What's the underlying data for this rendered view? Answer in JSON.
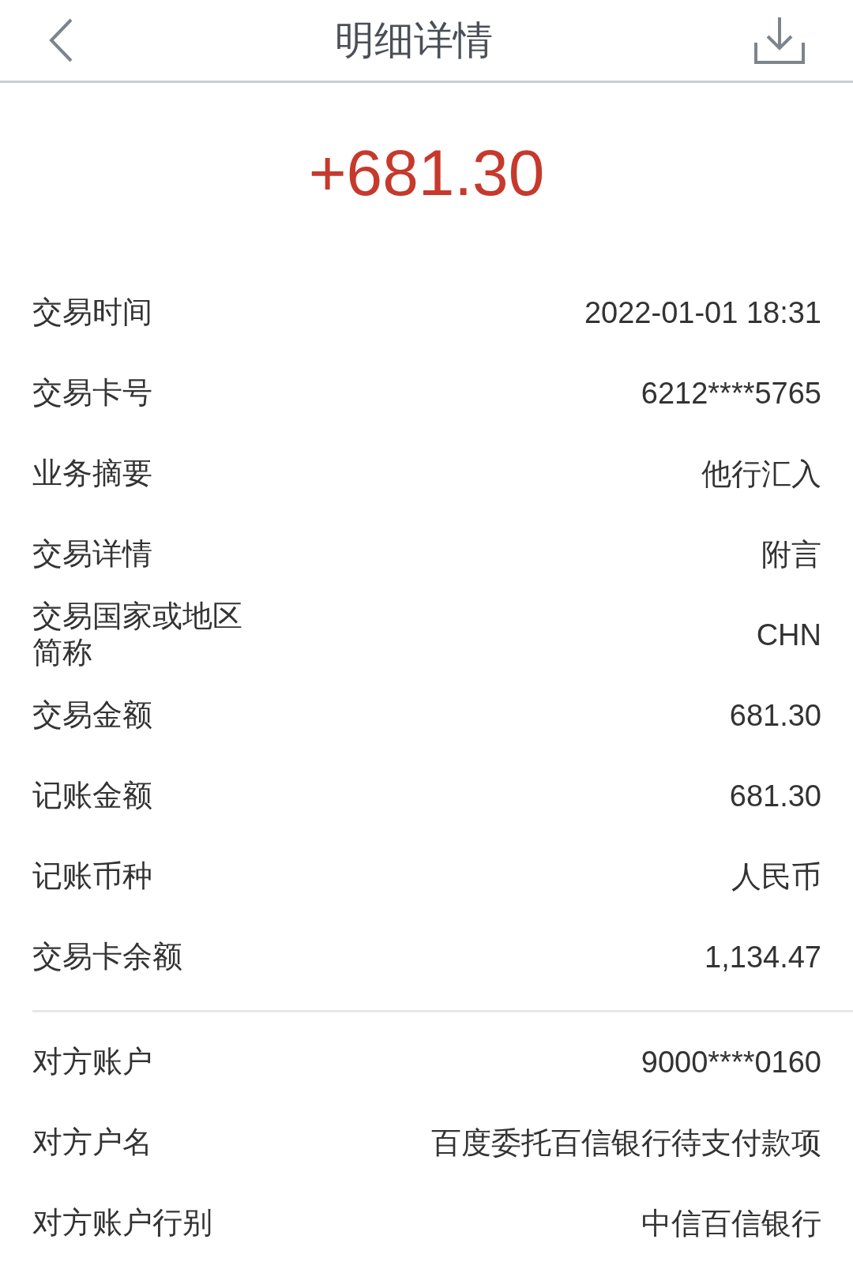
{
  "header": {
    "title": "明细详情"
  },
  "amount": "+681.30",
  "sections": [
    {
      "rows": [
        {
          "label": "交易时间",
          "value": "2022-01-01 18:31"
        },
        {
          "label": "交易卡号",
          "value": "6212****5765"
        },
        {
          "label": "业务摘要",
          "value": "他行汇入"
        },
        {
          "label": "交易详情",
          "value": "附言"
        },
        {
          "label": "交易国家或地区简称",
          "value": "CHN"
        },
        {
          "label": "交易金额",
          "value": "681.30"
        },
        {
          "label": "记账金额",
          "value": "681.30"
        },
        {
          "label": "记账币种",
          "value": "人民币"
        },
        {
          "label": "交易卡余额",
          "value": "1,134.47"
        }
      ]
    },
    {
      "rows": [
        {
          "label": "对方账户",
          "value": "9000****0160"
        },
        {
          "label": "对方户名",
          "value": "百度委托百信银行待支付款项"
        },
        {
          "label": "对方账户行别",
          "value": "中信百信银行"
        }
      ]
    }
  ]
}
